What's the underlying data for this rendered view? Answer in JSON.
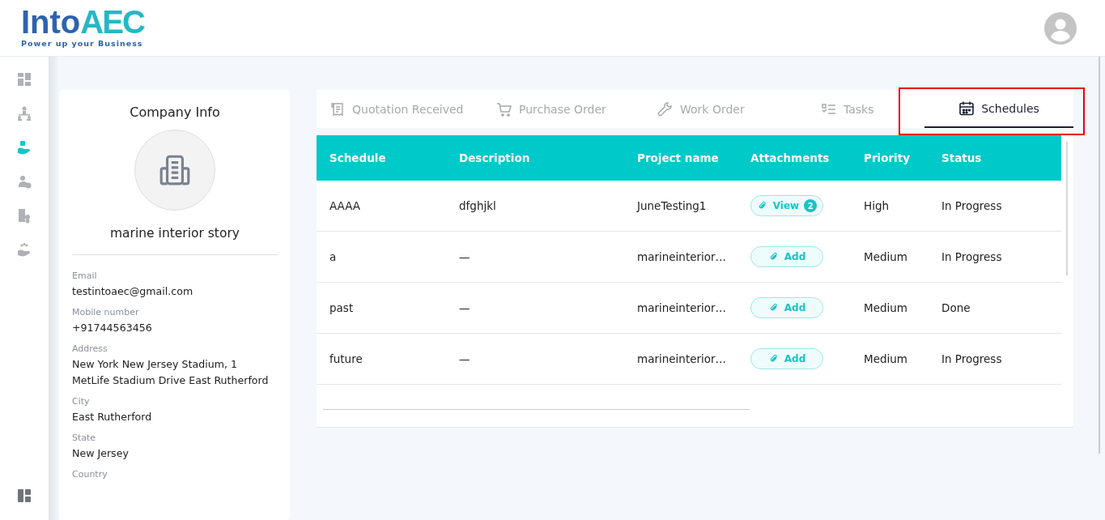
{
  "logo": {
    "name_part1": "Into",
    "name_part2": "AEC",
    "tagline": "Power up your Business"
  },
  "sidebar": {
    "items": [
      {
        "selected": false
      },
      {
        "selected": false
      },
      {
        "selected": true
      },
      {
        "selected": false
      },
      {
        "selected": false
      },
      {
        "selected": false
      }
    ]
  },
  "company": {
    "title": "Company Info",
    "name": "marine interior story",
    "fields": [
      {
        "label": "Email",
        "value": "testintoaec@gmail.com"
      },
      {
        "label": "Mobile number",
        "value": "+91744563456"
      },
      {
        "label": "Address",
        "value": "New York New Jersey Stadium, 1 MetLife Stadium Drive East Rutherford"
      },
      {
        "label": "City",
        "value": "East Rutherford"
      },
      {
        "label": "State",
        "value": "New Jersey"
      },
      {
        "label": "Country"
      }
    ]
  },
  "tabs": [
    {
      "label": "Quotation Received",
      "selected": false
    },
    {
      "label": "Purchase Order",
      "selected": false
    },
    {
      "label": "Work Order",
      "selected": false
    },
    {
      "label": "Tasks",
      "selected": false
    },
    {
      "label": "Schedules",
      "selected": true,
      "highlighted": true
    }
  ],
  "table": {
    "columns": [
      "Schedule",
      "Description",
      "Project name",
      "Attachments",
      "Priority",
      "Status"
    ],
    "rows": [
      {
        "schedule": "AAAA",
        "description": "dfghjkl",
        "project": "JuneTesting1",
        "attachment": {
          "label": "View",
          "count": "2"
        },
        "priority": "High",
        "status": "In Progress"
      },
      {
        "schedule": "a",
        "description": "—",
        "project": "marineinterior…",
        "attachment": {
          "label": "Add"
        },
        "priority": "Medium",
        "status": "In Progress"
      },
      {
        "schedule": "past",
        "description": "—",
        "project": "marineinterior…",
        "attachment": {
          "label": "Add"
        },
        "priority": "Medium",
        "status": "Done"
      },
      {
        "schedule": "future",
        "description": "—",
        "project": "marineinterior…",
        "attachment": {
          "label": "Add"
        },
        "priority": "Medium",
        "status": "In Progress"
      }
    ]
  }
}
